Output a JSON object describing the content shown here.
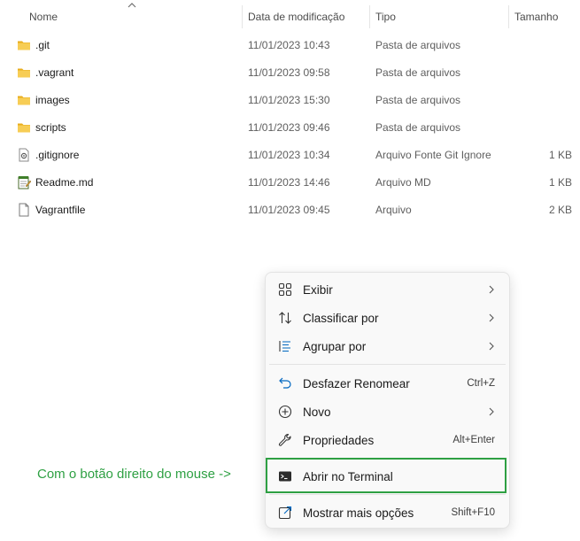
{
  "columns": {
    "name": "Nome",
    "date": "Data de modificação",
    "type": "Tipo",
    "size": "Tamanho"
  },
  "files": [
    {
      "name": ".git",
      "date": "11/01/2023 10:43",
      "type": "Pasta de arquivos",
      "size": "",
      "icon": "folder-icon"
    },
    {
      "name": ".vagrant",
      "date": "11/01/2023 09:58",
      "type": "Pasta de arquivos",
      "size": "",
      "icon": "folder-icon"
    },
    {
      "name": "images",
      "date": "11/01/2023 15:30",
      "type": "Pasta de arquivos",
      "size": "",
      "icon": "folder-icon"
    },
    {
      "name": "scripts",
      "date": "11/01/2023 09:46",
      "type": "Pasta de arquivos",
      "size": "",
      "icon": "folder-icon"
    },
    {
      "name": ".gitignore",
      "date": "11/01/2023 10:34",
      "type": "Arquivo Fonte Git Ignore",
      "size": "1 KB",
      "icon": "config-file-icon"
    },
    {
      "name": "Readme.md",
      "date": "11/01/2023 14:46",
      "type": "Arquivo MD",
      "size": "1 KB",
      "icon": "notepad-file-icon"
    },
    {
      "name": "Vagrantfile",
      "date": "11/01/2023 09:45",
      "type": "Arquivo",
      "size": "2 KB",
      "icon": "blank-file-icon"
    }
  ],
  "context_menu": {
    "items": [
      {
        "label": "Exibir",
        "shortcut": "",
        "icon": "grid-view-icon"
      },
      {
        "label": "Classificar por",
        "shortcut": "",
        "icon": "sort-icon"
      },
      {
        "label": "Agrupar por",
        "shortcut": "",
        "icon": "group-list-icon"
      },
      {
        "label": "Desfazer Renomear",
        "shortcut": "Ctrl+Z",
        "icon": "undo-icon"
      },
      {
        "label": "Novo",
        "shortcut": "",
        "icon": "new-plus-icon"
      },
      {
        "label": "Propriedades",
        "shortcut": "Alt+Enter",
        "icon": "wrench-icon"
      },
      {
        "label": "Abrir no Terminal",
        "shortcut": "",
        "icon": "terminal-icon"
      },
      {
        "label": "Mostrar mais opções",
        "shortcut": "Shift+F10",
        "icon": "more-options-icon"
      }
    ]
  },
  "annotation": {
    "text": "Com o botão direito do mouse ->",
    "color": "#2ea043"
  },
  "colors": {
    "folder": "#f3c546",
    "accent_blue": "#0067c0",
    "highlight": "#2ea043"
  }
}
